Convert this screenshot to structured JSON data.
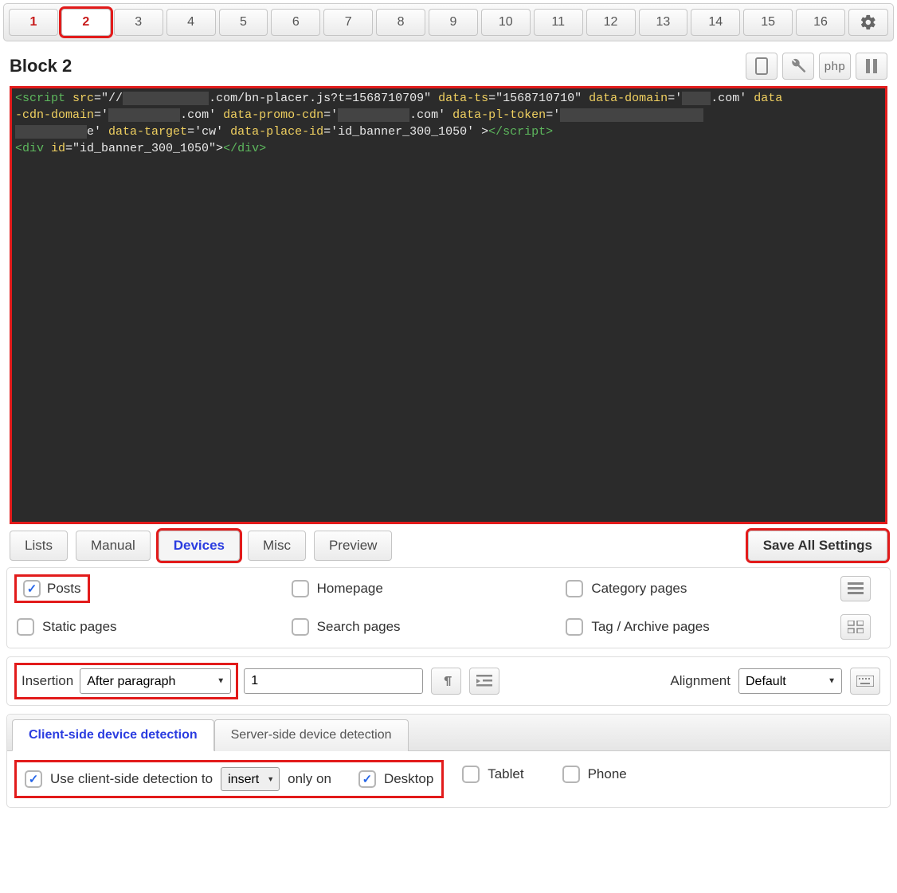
{
  "tabs": [
    "1",
    "2",
    "3",
    "4",
    "5",
    "6",
    "7",
    "8",
    "9",
    "10",
    "11",
    "12",
    "13",
    "14",
    "15",
    "16"
  ],
  "tabs_used": [
    0,
    1
  ],
  "tabs_active": 1,
  "block": {
    "title": "Block 2"
  },
  "toolbar_icons": {
    "php_label": "php"
  },
  "code": {
    "line1a": "<script ",
    "line1b": "src",
    "line1c": "=\"//",
    "line1d_redacted": "████████████",
    "line1e": ".com/bn-placer.js?t=1568710709\" ",
    "line1f": "data-ts",
    "line1g": "=\"1568710710\" ",
    "line1h": "data-domain",
    "line1i": "='",
    "line1j_redacted": "████",
    "line1k": ".com' ",
    "line1l": "data",
    "line2a": "-cdn-domain",
    "line2b": "='",
    "line2c_redacted": "██████████",
    "line2d": ".com' ",
    "line2e": "data-promo-cdn",
    "line2f": "='",
    "line2g_redacted": "██████████",
    "line2h": ".com' ",
    "line2i": "data-pl-token",
    "line2j": "='",
    "line2k_redacted": "████████████████████",
    "line3a_redacted": "██████████",
    "line3b": "e' ",
    "line3c": "data-target",
    "line3d": "='cw' ",
    "line3e": "data-place-id",
    "line3f": "='id_banner_300_1050' >",
    "line3g": "</script>",
    "line4a": "<div ",
    "line4b": "id",
    "line4c": "=\"id_banner_300_1050\">",
    "line4d": "</div>"
  },
  "option_tabs": {
    "lists": "Lists",
    "manual": "Manual",
    "devices": "Devices",
    "misc": "Misc",
    "preview": "Preview",
    "save": "Save All Settings"
  },
  "pages": {
    "posts": "Posts",
    "homepage": "Homepage",
    "category": "Category pages",
    "static": "Static pages",
    "search": "Search pages",
    "tag": "Tag / Archive pages"
  },
  "insertion": {
    "label": "Insertion",
    "select": "After paragraph",
    "value": "1",
    "alignment_label": "Alignment",
    "alignment_value": "Default"
  },
  "detection": {
    "tab_client": "Client-side device detection",
    "tab_server": "Server-side device detection",
    "use_label_pre": "Use client-side detection to",
    "action": "insert",
    "use_label_post": "only on",
    "desktop": "Desktop",
    "tablet": "Tablet",
    "phone": "Phone"
  }
}
